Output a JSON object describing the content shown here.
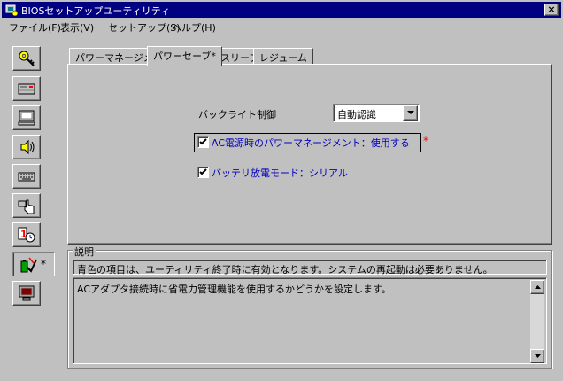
{
  "window": {
    "title": "BIOSセットアップユーティリティ",
    "close_label": "×"
  },
  "menu": [
    {
      "label": "ファイル(F)"
    },
    {
      "label": "表示(V)"
    },
    {
      "label": "セットアップ(S)"
    },
    {
      "label": "ヘルプ(H)"
    }
  ],
  "toolbar": {
    "active_marker": "*"
  },
  "tabs": [
    {
      "label": "パワーマネージメント"
    },
    {
      "label": "パワーセーブ*"
    },
    {
      "label": "スリープ"
    },
    {
      "label": "レジューム"
    }
  ],
  "settings": {
    "backlight_label": "バックライト制御",
    "backlight_value": "自動認識",
    "ac_power_label": "AC電源時のパワーマネージメント：使用する",
    "battery_label": "バッテリ放電モード：シリアル",
    "modified_marker": "*"
  },
  "description": {
    "legend": "説明",
    "note": "青色の項目は、ユーティリティ終了時に有効となります。システムの再起動は必要ありません。",
    "text": "ACアダプタ接続時に省電力管理機能を使用するかどうかを設定します。"
  }
}
